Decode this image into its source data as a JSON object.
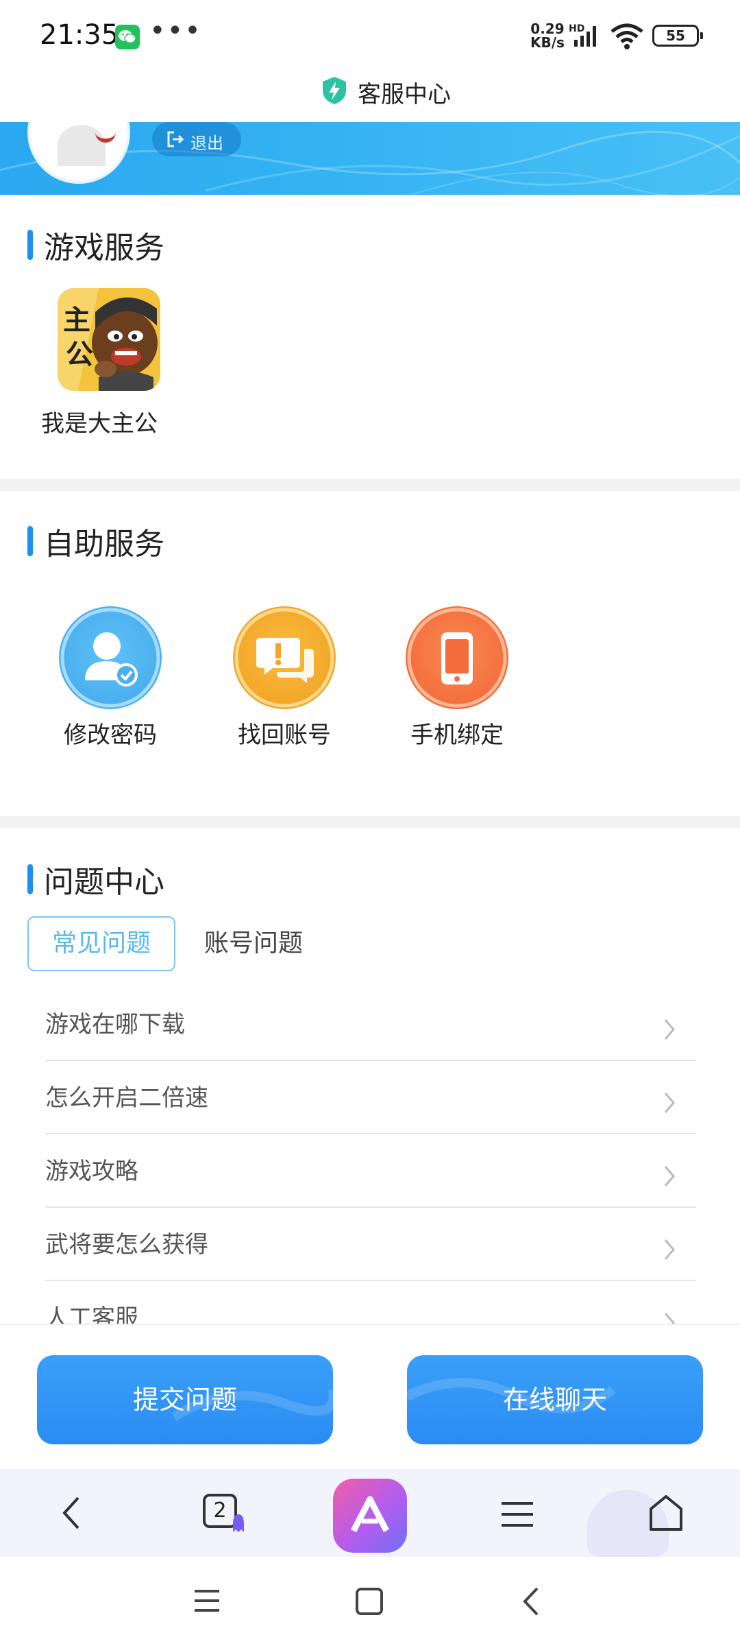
{
  "status_bar": {
    "time": "21:35",
    "dots": "•••",
    "net_speed_value": "0.29",
    "net_speed_unit": "KB/s",
    "hd": "HD",
    "battery": "55",
    "icons": [
      "wechat-icon",
      "signal-icon",
      "wifi-icon",
      "battery-icon"
    ]
  },
  "header": {
    "title": "客服中心",
    "icon": "shield-bolt-icon"
  },
  "banner": {
    "logout_label": "退出",
    "colors": {
      "from": "#2aa8f0",
      "to": "#48c0f6"
    }
  },
  "game_service": {
    "title": "游戏服务",
    "games": [
      {
        "name": "我是大主公",
        "icon": "game-icon-dazhugong"
      }
    ]
  },
  "self_service": {
    "title": "自助服务",
    "items": [
      {
        "label": "修改密码",
        "icon": "user-check-icon",
        "color": "#4db3f2"
      },
      {
        "label": "找回账号",
        "icon": "chat-alert-icon",
        "color": "#f5b02e"
      },
      {
        "label": "手机绑定",
        "icon": "phone-icon",
        "color": "#f57a45"
      }
    ]
  },
  "problem_center": {
    "title": "问题中心",
    "tabs": [
      {
        "label": "常见问题",
        "active": true
      },
      {
        "label": "账号问题",
        "active": false
      }
    ],
    "faqs": [
      "游戏在哪下载",
      "怎么开启二倍速",
      "游戏攻略",
      "武将要怎么获得",
      "人工客服"
    ]
  },
  "actions": {
    "submit_label": "提交问题",
    "chat_label": "在线聊天",
    "accent": "#2a8cf3"
  },
  "browser_bar": {
    "tab_count": "2",
    "icons": [
      "back-icon",
      "tabs-icon",
      "ai-assistant-icon",
      "menu-icon",
      "home-icon"
    ]
  },
  "system_nav": {
    "icons": [
      "recent-apps-icon",
      "home-square-icon",
      "nav-back-icon"
    ]
  }
}
